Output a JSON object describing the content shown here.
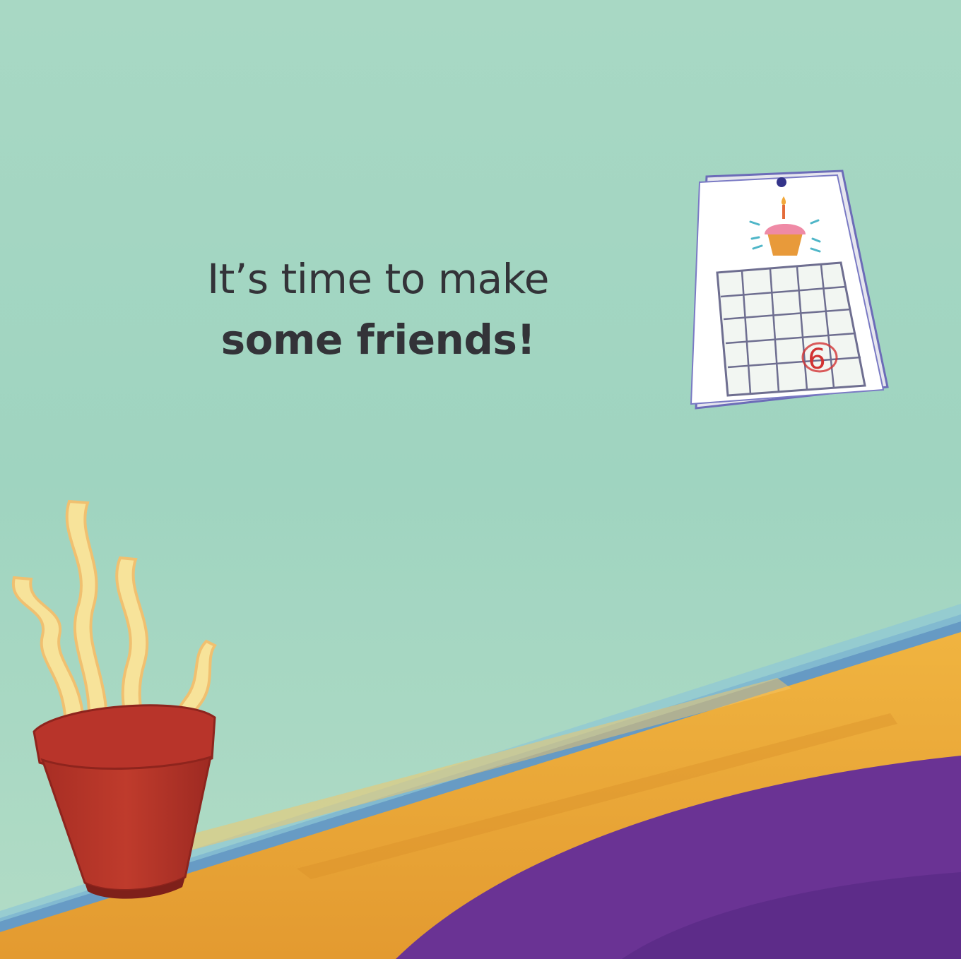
{
  "caption": {
    "line1": "It’s time to make",
    "line2": "some friends!"
  },
  "calendar": {
    "circled_date": "6"
  },
  "icons": {
    "calendar": "wall-calendar-icon",
    "cupcake": "cupcake-icon",
    "plant": "potted-plant-icon"
  },
  "colors": {
    "sky": "#a5d6c0",
    "table": "#e8a83a",
    "purple": "#6a3394",
    "pot": "#b0352a",
    "text": "#333338"
  }
}
